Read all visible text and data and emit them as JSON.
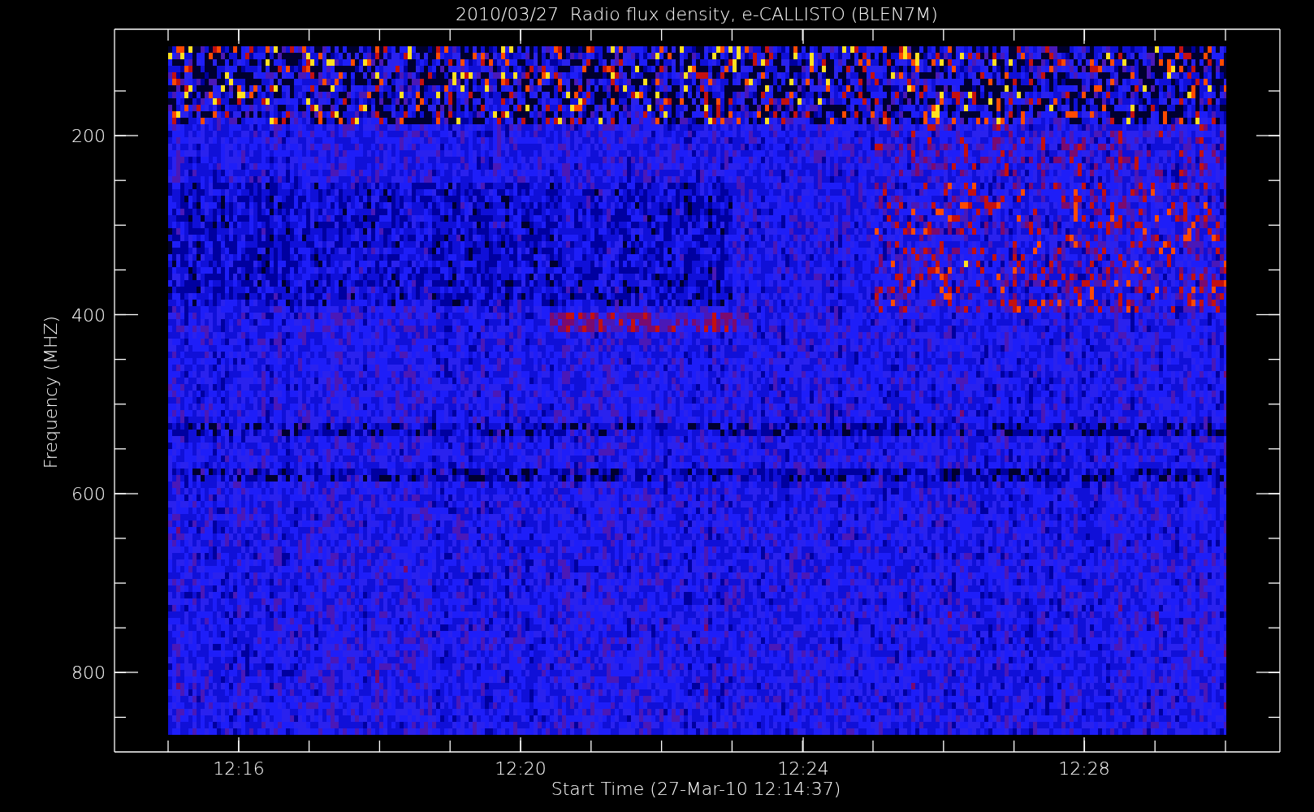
{
  "title": "2010/03/27  Radio flux density, e-CALLISTO (BLEN7M)",
  "y_axis": {
    "label": "Frequency (MHZ)",
    "ticks": [
      "200",
      "400",
      "600",
      "800"
    ]
  },
  "x_axis": {
    "label": "Start Time (27-Mar-10 12:14:37)",
    "ticks": [
      "12:16",
      "12:20",
      "12:24",
      "12:28"
    ]
  }
}
